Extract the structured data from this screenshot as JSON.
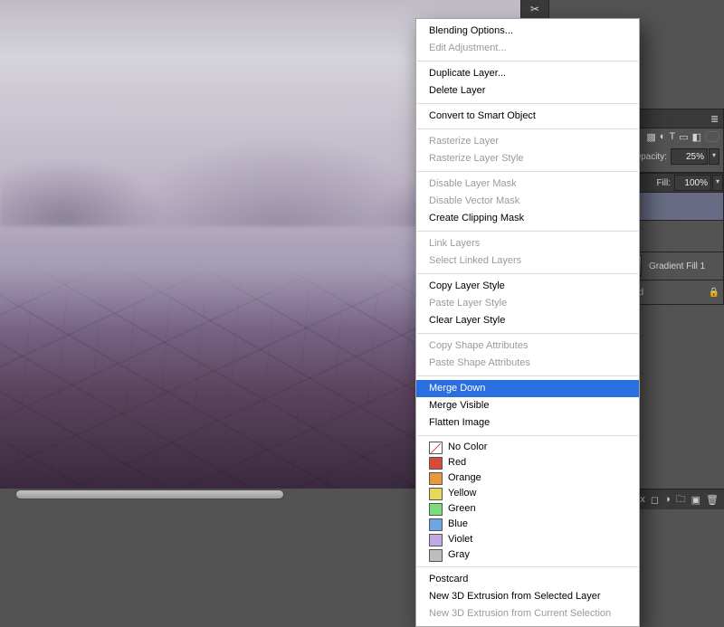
{
  "tool_strip": {
    "icon_name": "scissors-icon"
  },
  "layers_panel": {
    "opacity_label": "Opacity:",
    "opacity_value": "25%",
    "fill_label": "Fill:",
    "fill_value": "100%",
    "layer_gradient": "Gradient Fill 1",
    "layer_background_suffix": "ound"
  },
  "menu": {
    "blending_options": "Blending Options...",
    "edit_adjustment": "Edit Adjustment...",
    "duplicate_layer": "Duplicate Layer...",
    "delete_layer": "Delete Layer",
    "convert_smart": "Convert to Smart Object",
    "rasterize_layer": "Rasterize Layer",
    "rasterize_style": "Rasterize Layer Style",
    "disable_layer_mask": "Disable Layer Mask",
    "disable_vector_mask": "Disable Vector Mask",
    "create_clip_mask": "Create Clipping Mask",
    "link_layers": "Link Layers",
    "select_linked": "Select Linked Layers",
    "copy_style": "Copy Layer Style",
    "paste_style": "Paste Layer Style",
    "clear_style": "Clear Layer Style",
    "copy_shape_attr": "Copy Shape Attributes",
    "paste_shape_attr": "Paste Shape Attributes",
    "merge_down": "Merge Down",
    "merge_visible": "Merge Visible",
    "flatten": "Flatten Image",
    "no_color": "No Color",
    "red": "Red",
    "orange": "Orange",
    "yellow": "Yellow",
    "green": "Green",
    "blue": "Blue",
    "violet": "Violet",
    "gray": "Gray",
    "postcard": "Postcard",
    "new_3d_sel_layer": "New 3D Extrusion from Selected Layer",
    "new_3d_cur_sel": "New 3D Extrusion from Current Selection"
  },
  "swatches": {
    "red": "#d84a3a",
    "orange": "#e79a3a",
    "yellow": "#e7d85a",
    "green": "#7bdc7a",
    "blue": "#6ea5e6",
    "violet": "#c3a8e6",
    "gray": "#bdbdbd"
  }
}
